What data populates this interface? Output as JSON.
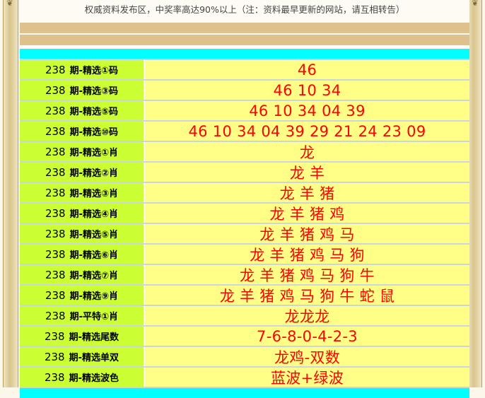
{
  "notice": "权威资料发布区，中奖率高达90%以上（注：资料最早更新的网站，请互相转告）",
  "rows": [
    {
      "issue": "238",
      "label": "期-精选①码",
      "value": "46"
    },
    {
      "issue": "238",
      "label": "期-精选③码",
      "value": "46 10 34"
    },
    {
      "issue": "238",
      "label": "期-精选⑤码",
      "value": "46 10 34 04 39"
    },
    {
      "issue": "238",
      "label": "期-精选⑩码",
      "value": "46 10 34 04 39 29 21 24 23 09"
    },
    {
      "issue": "238",
      "label": "期-精选①肖",
      "value": "龙"
    },
    {
      "issue": "238",
      "label": "期-精选②肖",
      "value": "龙 羊"
    },
    {
      "issue": "238",
      "label": "期-精选③肖",
      "value": "龙 羊 猪"
    },
    {
      "issue": "238",
      "label": "期-精选④肖",
      "value": "龙 羊 猪 鸡"
    },
    {
      "issue": "238",
      "label": "期-精选⑤肖",
      "value": "龙 羊 猪 鸡 马"
    },
    {
      "issue": "238",
      "label": "期-精选⑥肖",
      "value": "龙 羊 猪 鸡 马 狗"
    },
    {
      "issue": "238",
      "label": "期-精选⑦肖",
      "value": "龙 羊 猪 鸡 马 狗 牛"
    },
    {
      "issue": "238",
      "label": "期-精选⑨肖",
      "value": "龙 羊 猪 鸡 马 狗 牛 蛇 鼠"
    },
    {
      "issue": "238",
      "label": "期-平特①肖",
      "value": "龙龙龙"
    },
    {
      "issue": "238",
      "label": "期-精选尾数",
      "value": "7-6-8-0-4-2-3"
    },
    {
      "issue": "238",
      "label": "期-精选单双",
      "value": "龙鸡-双数"
    },
    {
      "issue": "238",
      "label": "期-精选波色",
      "value": "蓝波+绿波"
    }
  ]
}
